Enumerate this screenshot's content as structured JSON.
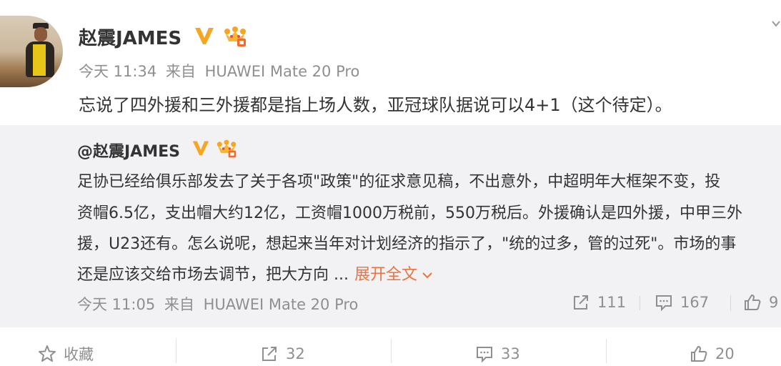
{
  "post": {
    "author": "赵震JAMES",
    "time": "今天 11:34",
    "source_prefix": "来自",
    "source": "HUAWEI Mate 20 Pro",
    "text": "忘说了四外援和三外援都是指上场人数，亚冠球队据说可以4+1（这个待定）。"
  },
  "repost": {
    "author": "@赵震JAMES",
    "lines": [
      "足协已经给俱乐部发去了关于各项\"政策\"的征求意见稿，不出意外，中超明年大框架不变，投",
      "资帽6.5亿，支出帽大约12亿，工资帽1000万税前，550万税后。外援确认是四外援，中甲三外",
      "援，U23还有。怎么说呢，想起来当年对计划经济的指示了，\"统的过多，管的过死\"。市场的事",
      "还是应该交给市场去调节，把大方向 ..."
    ],
    "expand_label": "展开全文",
    "time": "今天 11:05",
    "source_prefix": "来自",
    "source": "HUAWEI Mate 20 Pro",
    "repost_count": "111",
    "comment_count": "167",
    "like_count": "9"
  },
  "actions": {
    "favorite_label": "收藏",
    "repost_count": "32",
    "comment_count": "33",
    "like_count": "20"
  },
  "colors": {
    "accent_orange": "#eb7340",
    "verified_gold": "#f5a623",
    "meta_gray": "#8f8f8f",
    "repost_bg": "#f2f2f5"
  }
}
